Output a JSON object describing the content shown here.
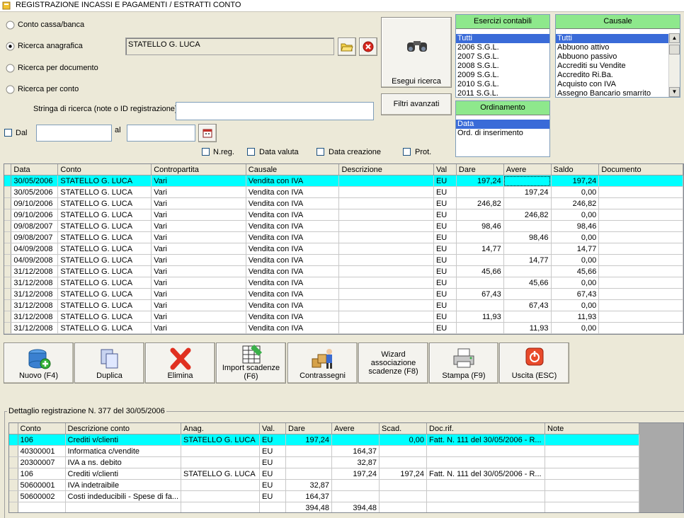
{
  "window": {
    "title": "REGISTRAZIONE INCASSI E PAGAMENTI / ESTRATTI CONTO"
  },
  "search": {
    "options": [
      "Conto cassa/banca",
      "Ricerca anagrafica",
      "Ricerca per documento",
      "Ricerca per conto"
    ],
    "selected_option": "Ricerca anagrafica",
    "anagrafica_value": "STATELLO G. LUCA",
    "stringa_label": "Stringa di ricerca (note o ID registrazione)",
    "stringa_value": "",
    "dal_label": "Dal",
    "al_label": "al",
    "dal_value": "",
    "al_value": "",
    "checkboxes": [
      "N.reg.",
      "Data valuta",
      "Data creazione",
      "Prot."
    ],
    "esegui_label": "Esegui ricerca",
    "filtri_label": "Filtri avanzati"
  },
  "esercizi": {
    "header": "Esercizi contabili",
    "items": [
      "Tutti",
      "2006 S.G.L.",
      "2007 S.G.L.",
      "2008 S.G.L.",
      "2009 S.G.L.",
      "2010 S.G.L.",
      "2011 S.G.L."
    ],
    "selected": "Tutti"
  },
  "causale": {
    "header": "Causale",
    "items": [
      "Tutti",
      "Abbuono attivo",
      "Abbuono passivo",
      "Accrediti su Vendite",
      "Accredito Ri.Ba.",
      "Acquisto con IVA",
      "Assegno Bancario smarrito"
    ],
    "selected": "Tutti"
  },
  "ordinamento": {
    "header": "Ordinamento",
    "items": [
      "Data",
      "Ord. di inserimento"
    ],
    "selected": "Data"
  },
  "main_grid": {
    "columns": [
      "Data",
      "Conto",
      "Contropartita",
      "Causale",
      "Descrizione",
      "Val",
      "Dare",
      "Avere",
      "Saldo",
      "Documento"
    ],
    "rows": [
      [
        "30/05/2006",
        "STATELLO G. LUCA",
        "Vari",
        "Vendita con IVA",
        "",
        "EU",
        "197,24",
        "",
        "197,24",
        ""
      ],
      [
        "30/05/2006",
        "STATELLO G. LUCA",
        "Vari",
        "Vendita con IVA",
        "",
        "EU",
        "",
        "197,24",
        "0,00",
        ""
      ],
      [
        "09/10/2006",
        "STATELLO G. LUCA",
        "Vari",
        "Vendita con IVA",
        "",
        "EU",
        "246,82",
        "",
        "246,82",
        ""
      ],
      [
        "09/10/2006",
        "STATELLO G. LUCA",
        "Vari",
        "Vendita con IVA",
        "",
        "EU",
        "",
        "246,82",
        "0,00",
        ""
      ],
      [
        "09/08/2007",
        "STATELLO G. LUCA",
        "Vari",
        "Vendita con IVA",
        "",
        "EU",
        "98,46",
        "",
        "98,46",
        ""
      ],
      [
        "09/08/2007",
        "STATELLO G. LUCA",
        "Vari",
        "Vendita con IVA",
        "",
        "EU",
        "",
        "98,46",
        "0,00",
        ""
      ],
      [
        "04/09/2008",
        "STATELLO G. LUCA",
        "Vari",
        "Vendita con IVA",
        "",
        "EU",
        "14,77",
        "",
        "14,77",
        ""
      ],
      [
        "04/09/2008",
        "STATELLO G. LUCA",
        "Vari",
        "Vendita con IVA",
        "",
        "EU",
        "",
        "14,77",
        "0,00",
        ""
      ],
      [
        "31/12/2008",
        "STATELLO G. LUCA",
        "Vari",
        "Vendita con IVA",
        "",
        "EU",
        "45,66",
        "",
        "45,66",
        ""
      ],
      [
        "31/12/2008",
        "STATELLO G. LUCA",
        "Vari",
        "Vendita con IVA",
        "",
        "EU",
        "",
        "45,66",
        "0,00",
        ""
      ],
      [
        "31/12/2008",
        "STATELLO G. LUCA",
        "Vari",
        "Vendita con IVA",
        "",
        "EU",
        "67,43",
        "",
        "67,43",
        ""
      ],
      [
        "31/12/2008",
        "STATELLO G. LUCA",
        "Vari",
        "Vendita con IVA",
        "",
        "EU",
        "",
        "67,43",
        "0,00",
        ""
      ],
      [
        "31/12/2008",
        "STATELLO G. LUCA",
        "Vari",
        "Vendita con IVA",
        "",
        "EU",
        "11,93",
        "",
        "11,93",
        ""
      ],
      [
        "31/12/2008",
        "STATELLO G. LUCA",
        "Vari",
        "Vendita con IVA",
        "",
        "EU",
        "",
        "11,93",
        "0,00",
        ""
      ]
    ]
  },
  "toolbar": {
    "nuovo": "Nuovo (F4)",
    "duplica": "Duplica",
    "elimina": "Elimina",
    "import_1": "Import scadenze",
    "import_2": "(F6)",
    "contrassegni": "Contrassegni",
    "wizard_1": "Wizard",
    "wizard_2": "associazione",
    "wizard_3": "scadenze (F8)",
    "stampa": "Stampa (F9)",
    "uscita": "Uscita (ESC)"
  },
  "detail": {
    "title": "Dettaglio registrazione N. 377 del 30/05/2006",
    "columns": [
      "Conto",
      "Descrizione conto",
      "Anag.",
      "Val.",
      "Dare",
      "Avere",
      "Scad.",
      "Doc.rif.",
      "Note"
    ],
    "rows": [
      [
        "106",
        "Crediti v/clienti",
        "STATELLO G. LUCA",
        "EU",
        "197,24",
        "",
        "0,00",
        "Fatt. N. 111 del 30/05/2006 - R...",
        ""
      ],
      [
        "40300001",
        "Informatica c/vendite",
        "",
        "EU",
        "",
        "164,37",
        "",
        "",
        ""
      ],
      [
        "20300007",
        "IVA a ns. debito",
        "",
        "EU",
        "",
        "32,87",
        "",
        "",
        ""
      ],
      [
        "106",
        "Crediti v/clienti",
        "STATELLO G. LUCA",
        "EU",
        "",
        "197,24",
        "197,24",
        "Fatt. N. 111 del 30/05/2006 - R...",
        ""
      ],
      [
        "50600001",
        "IVA indetraibile",
        "",
        "EU",
        "32,87",
        "",
        "",
        "",
        ""
      ],
      [
        "50600002",
        "Costi indeducibili - Spese di fa...",
        "",
        "EU",
        "164,37",
        "",
        "",
        "",
        ""
      ]
    ],
    "totals": {
      "dare": "394,48",
      "avere": "394,48"
    }
  }
}
